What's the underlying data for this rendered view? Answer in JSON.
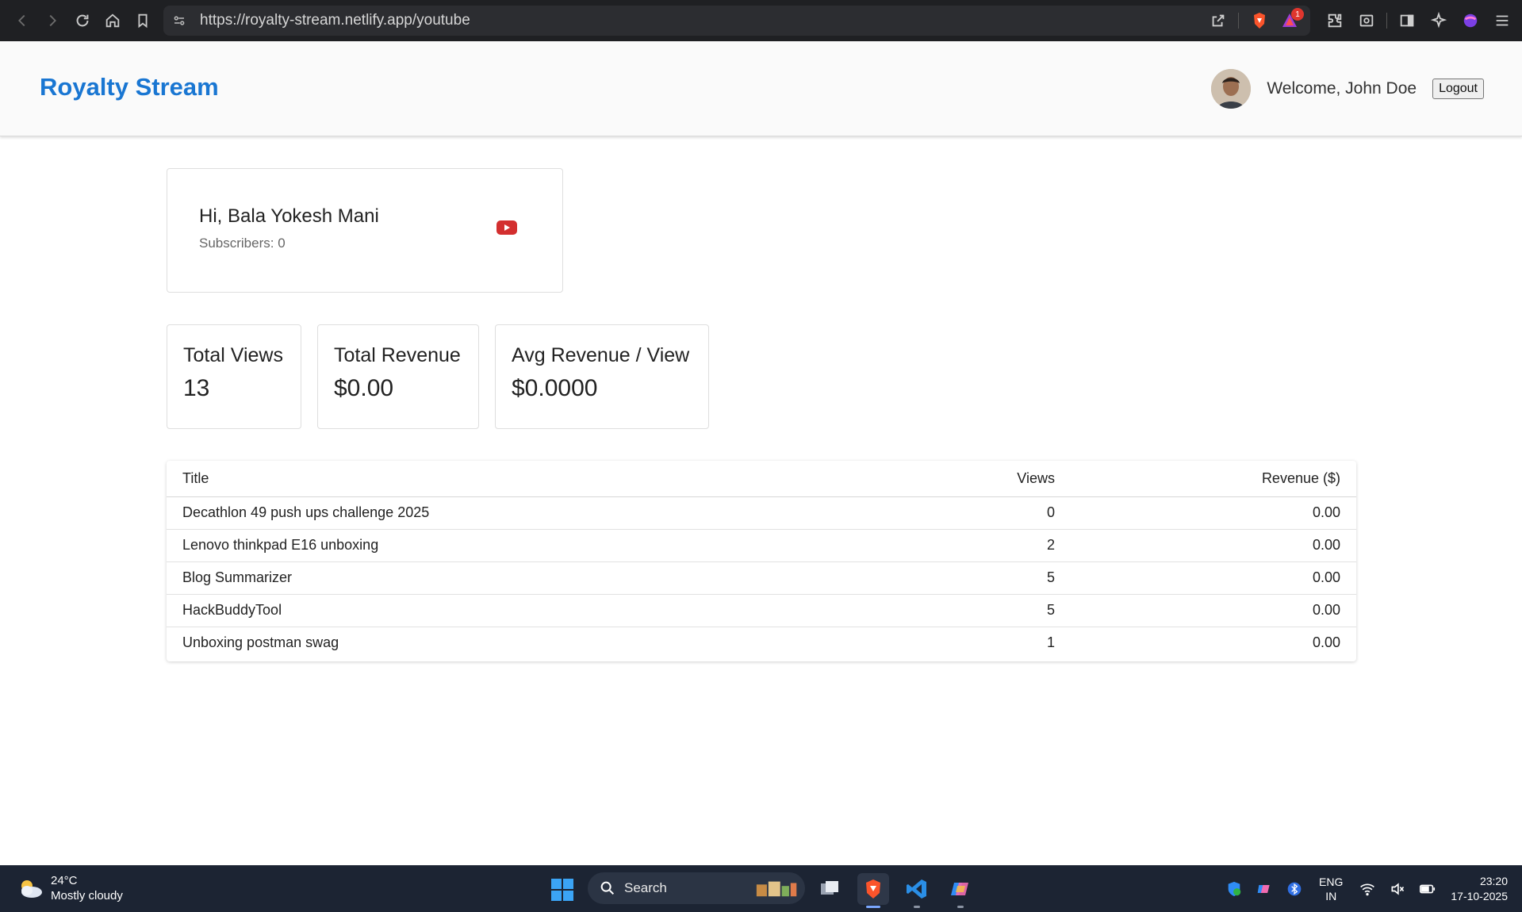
{
  "browser": {
    "url": "https://royalty-stream.netlify.app/youtube",
    "notification_count": "1"
  },
  "header": {
    "brand": "Royalty Stream",
    "welcome": "Welcome, John Doe",
    "logout_label": "Logout"
  },
  "channel": {
    "greeting": "Hi, Bala Yokesh Mani",
    "subscribers": "Subscribers: 0"
  },
  "stats": [
    {
      "label": "Total Views",
      "value": "13"
    },
    {
      "label": "Total Revenue",
      "value": "$0.00"
    },
    {
      "label": "Avg Revenue / View",
      "value": "$0.0000"
    }
  ],
  "table": {
    "headers": {
      "title": "Title",
      "views": "Views",
      "revenue": "Revenue ($)"
    },
    "rows": [
      {
        "title": "Decathlon 49 push ups challenge 2025",
        "views": "0",
        "revenue": "0.00"
      },
      {
        "title": "Lenovo thinkpad E16 unboxing",
        "views": "2",
        "revenue": "0.00"
      },
      {
        "title": "Blog Summarizer",
        "views": "5",
        "revenue": "0.00"
      },
      {
        "title": "HackBuddyTool",
        "views": "5",
        "revenue": "0.00"
      },
      {
        "title": "Unboxing postman swag",
        "views": "1",
        "revenue": "0.00"
      }
    ]
  },
  "taskbar": {
    "temperature": "24°C",
    "weather": "Mostly cloudy",
    "search_label": "Search",
    "lang_top": "ENG",
    "lang_bottom": "IN",
    "time": "23:20",
    "date": "17-10-2025"
  },
  "colors": {
    "brand": "#1976d2",
    "youtube": "#d32f2f",
    "browser_bg": "#1f2023",
    "taskbar_bg": "#1c2433"
  }
}
